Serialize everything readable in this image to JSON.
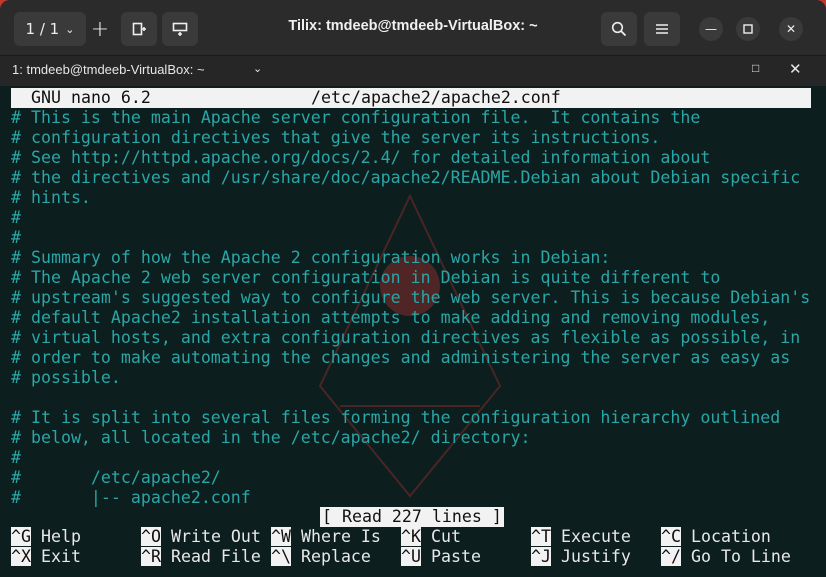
{
  "header": {
    "session_counter": "1 / 1",
    "window_title": "Tilix: tmdeeb@tmdeeb-VirtualBox: ~",
    "icons": [
      "add-session-icon",
      "split-right-icon",
      "split-down-icon",
      "search-icon",
      "hamburger-menu-icon",
      "minimize-icon",
      "maximize-icon",
      "close-icon"
    ]
  },
  "terminal_tab": {
    "title": "1: tmdeeb@tmdeeb-VirtualBox: ~"
  },
  "nano": {
    "version": "GNU nano 6.2",
    "filename": "/etc/apache2/apache2.conf",
    "lines": [
      "# This is the main Apache server configuration file.  It contains the",
      "# configuration directives that give the server its instructions.",
      "# See http://httpd.apache.org/docs/2.4/ for detailed information about",
      "# the directives and /usr/share/doc/apache2/README.Debian about Debian specific",
      "# hints.",
      "#",
      "#",
      "# Summary of how the Apache 2 configuration works in Debian:",
      "# The Apache 2 web server configuration in Debian is quite different to",
      "# upstream's suggested way to configure the web server. This is because Debian's",
      "# default Apache2 installation attempts to make adding and removing modules,",
      "# virtual hosts, and extra configuration directives as flexible as possible, in",
      "# order to make automating the changes and administering the server as easy as",
      "# possible.",
      "",
      "# It is split into several files forming the configuration hierarchy outlined",
      "# below, all located in the /etc/apache2/ directory:",
      "#",
      "#       /etc/apache2/",
      "#       |-- apache2.conf"
    ],
    "status": "[ Read 227 lines ]",
    "shortcuts_row1": [
      {
        "key": "^G",
        "label": "Help"
      },
      {
        "key": "^O",
        "label": "Write Out"
      },
      {
        "key": "^W",
        "label": "Where Is"
      },
      {
        "key": "^K",
        "label": "Cut"
      },
      {
        "key": "^T",
        "label": "Execute"
      },
      {
        "key": "^C",
        "label": "Location"
      }
    ],
    "shortcuts_row2": [
      {
        "key": "^X",
        "label": "Exit"
      },
      {
        "key": "^R",
        "label": "Read File"
      },
      {
        "key": "^\\",
        "label": "Replace"
      },
      {
        "key": "^U",
        "label": "Paste"
      },
      {
        "key": "^J",
        "label": "Justify"
      },
      {
        "key": "^/",
        "label": "Go To Line"
      }
    ]
  },
  "colors": {
    "comment": "#2aa6a6",
    "terminal_bg": "#0c1e1e",
    "header_bg": "#2b2b2b"
  }
}
